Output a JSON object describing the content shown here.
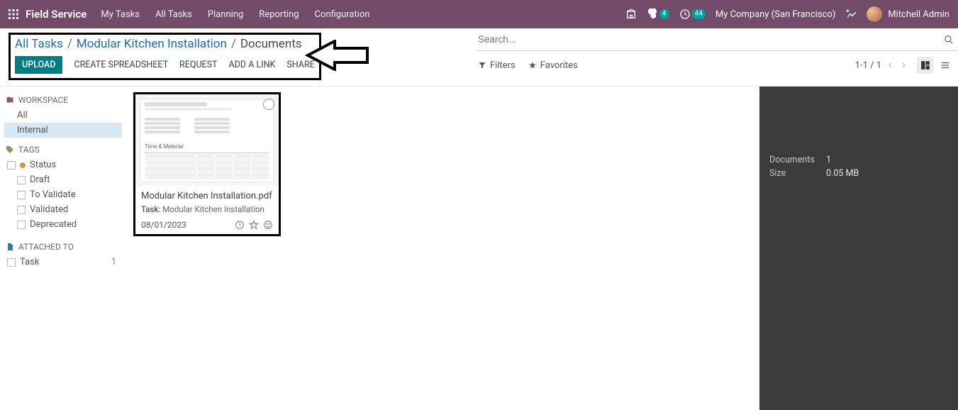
{
  "nav": {
    "brand": "Field Service",
    "items": [
      "My Tasks",
      "All Tasks",
      "Planning",
      "Reporting",
      "Configuration"
    ],
    "chat_badge": "4",
    "clock_badge": "44",
    "company": "My Company (San Francisco)",
    "user": "Mitchell Admin"
  },
  "breadcrumb": {
    "a": "All Tasks",
    "b": "Modular Kitchen Installation",
    "c": "Documents"
  },
  "actions": {
    "upload": "UPLOAD",
    "spreadsheet": "CREATE SPREADSHEET",
    "request": "REQUEST",
    "addlink": "ADD A LINK",
    "share": "SHARE"
  },
  "search": {
    "placeholder": "Search..."
  },
  "filters": {
    "filters": "Filters",
    "favorites": "Favorites"
  },
  "pager": {
    "range": "1-1 / 1"
  },
  "sidebar": {
    "workspace_label": "WORKSPACE",
    "all": "All",
    "internal": "Internal",
    "tags_label": "TAGS",
    "status": "Status",
    "draft": "Draft",
    "to_validate": "To Validate",
    "validated": "Validated",
    "deprecated": "Deprecated",
    "attached_label": "ATTACHED TO",
    "task": "Task",
    "task_count": "1"
  },
  "doc": {
    "title": "Modular Kitchen Installation.pdf",
    "task_label": "Task:",
    "task_value": "Modular Kitchen Installation",
    "date": "08/01/2023",
    "thumb_section": "Time & Material"
  },
  "panel": {
    "documents_k": "Documents",
    "documents_v": "1",
    "size_k": "Size",
    "size_v": "0.05 MB"
  }
}
